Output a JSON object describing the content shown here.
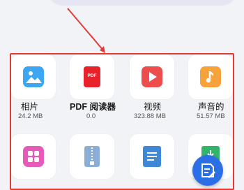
{
  "categories": [
    {
      "label": "相片",
      "size": "24.2 MB",
      "icon": "image-icon",
      "color": "#3da6f2"
    },
    {
      "label": "PDF 阅读器",
      "size": "0.0",
      "icon": "pdf-icon",
      "color": "#e8222b"
    },
    {
      "label": "视频",
      "size": "323.88 MB",
      "icon": "play-icon",
      "color": "#ee4d4d"
    },
    {
      "label": "声音的",
      "size": "51.57 MB",
      "icon": "music-icon",
      "color": "#f7a23a"
    }
  ],
  "second_row_icons": [
    {
      "icon": "apps-icon",
      "color": "#e45bb9"
    },
    {
      "icon": "zip-icon",
      "color": "#8aaed6"
    },
    {
      "icon": "document-icon",
      "color": "#3f88d6"
    },
    {
      "icon": "download-icon",
      "color": "#34b36a"
    }
  ],
  "pdf_badge": "PDF",
  "fab_icon": "edit-note-icon"
}
